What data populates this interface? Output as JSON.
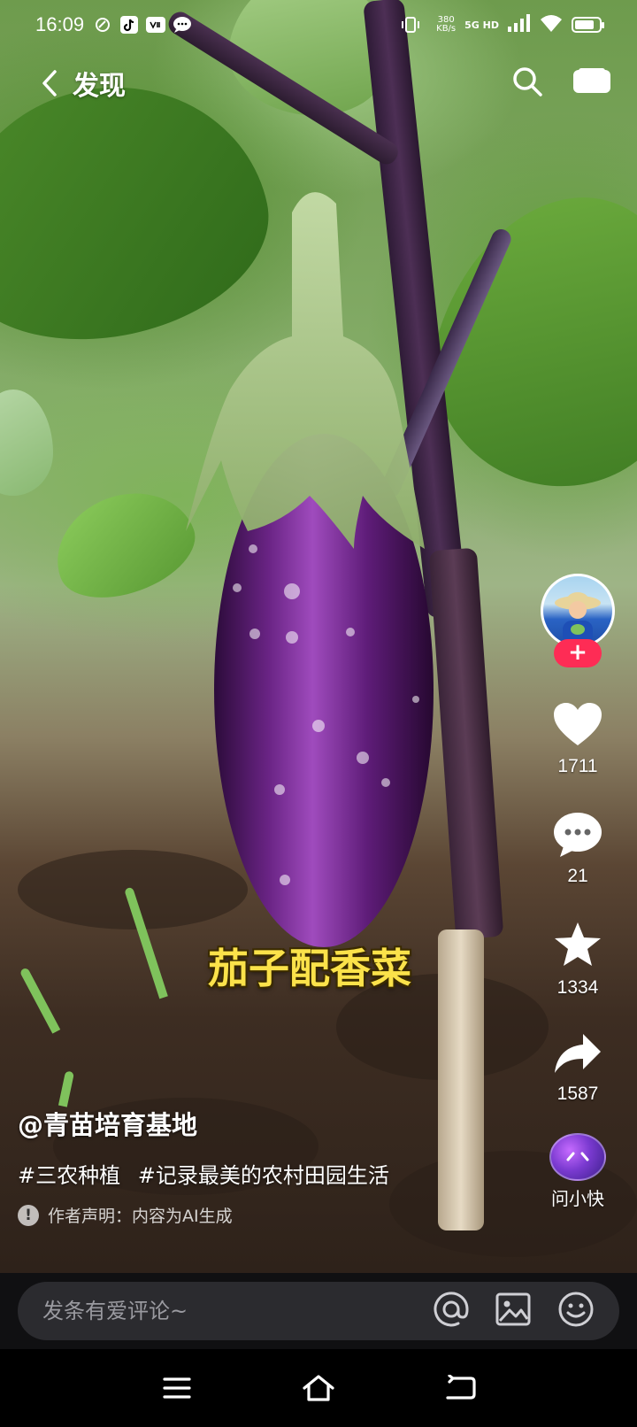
{
  "status_bar": {
    "time": "16:09",
    "speed_value": "380",
    "speed_unit": "KB/s",
    "network": "5G HD",
    "icons": [
      "sync-icon",
      "tiktok-icon",
      "vlog-icon",
      "chat-bubble-icon",
      "vibrate-icon",
      "signal-icon",
      "wifi-icon",
      "battery-icon"
    ]
  },
  "top_nav": {
    "title": "发现",
    "icons": [
      "back-arrow-icon",
      "search-icon",
      "video-card-icon"
    ]
  },
  "video": {
    "subtitle": "茄子配香菜"
  },
  "actions": {
    "follow_label": "+",
    "likes": "1711",
    "comments": "21",
    "favorites": "1334",
    "shares": "1587",
    "ai_label": "问小快"
  },
  "info": {
    "author": "@青苗培育基地",
    "tags": [
      "#三农种植",
      "#记录最美的农村田园生活"
    ],
    "disclaimer": "作者声明：内容为AI生成"
  },
  "comment_bar": {
    "placeholder": "发条有爱评论~",
    "icons": [
      "at-icon",
      "image-icon",
      "emoji-icon"
    ]
  },
  "colors": {
    "accent": "#fe2c55",
    "subtitle": "#fbe24a",
    "comment_box": "#2b2b2f"
  }
}
